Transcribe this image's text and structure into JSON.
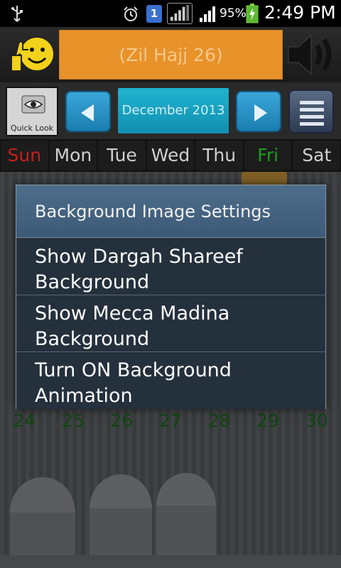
{
  "status_bar": {
    "battery_percent": "95%",
    "time": "2:49 PM",
    "sim_slot": "1",
    "icons": [
      "usb-icon",
      "alarm-icon",
      "sim-icon",
      "signal-icon",
      "signal-icon",
      "battery-charging-icon"
    ]
  },
  "header": {
    "hijri_date": "(Zil Hajj 26)",
    "icons": [
      "thumbs-up-smiley-icon",
      "speaker-icon"
    ]
  },
  "nav": {
    "quick_look_label": "Quick Look",
    "month_label": "December 2013",
    "icons": [
      "eye-icon",
      "prev-arrow-icon",
      "next-arrow-icon",
      "menu-list-icon"
    ]
  },
  "weekdays": [
    "Sun",
    "Mon",
    "Tue",
    "Wed",
    "Thu",
    "Fri",
    "Sat"
  ],
  "visible_dates_row": [
    "24",
    "25",
    "26",
    "27",
    "28",
    "29",
    "30"
  ],
  "dialog": {
    "title": "Background Image Settings",
    "options": [
      "Show Dargah Shareef Background",
      "Show Mecca Madina Background",
      "Turn ON Background Animation"
    ]
  },
  "colors": {
    "sunday": "#c81e1e",
    "friday": "#1f9b1f",
    "hijri_bg": "#e8922a",
    "nav_blue": "#1b7eb0",
    "dialog_title_bg": "#3d5a77",
    "dialog_bg": "#24303c"
  }
}
